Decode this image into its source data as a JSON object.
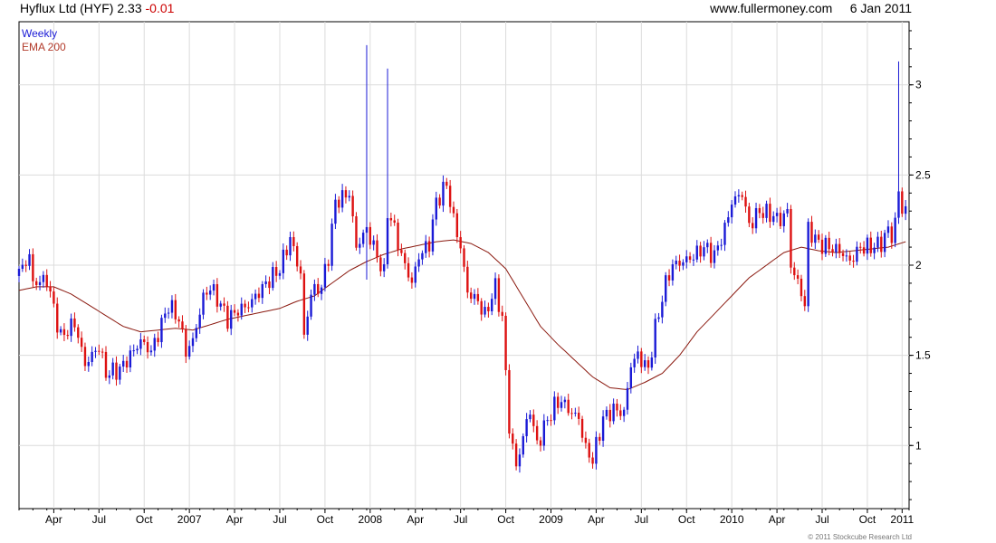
{
  "header": {
    "company": "Hyflux Ltd (HYF)",
    "price": "2.33",
    "change": "-0.01",
    "site": "www.fullermoney.com",
    "date": "6 Jan 2011"
  },
  "footer": {
    "copyright": "© 2011 Stockcube Research Ltd"
  },
  "colors": {
    "up": "#1a1ad6",
    "down": "#dd1111",
    "ema": "#8b1a10",
    "grid": "#dcdcdc"
  },
  "chart_data": {
    "type": "candlestick",
    "legend": [
      "Weekly",
      "EMA 200"
    ],
    "xlim": [
      0,
      256
    ],
    "ylim": [
      0.65,
      3.35
    ],
    "y_ticks": [
      1,
      1.5,
      2,
      2.5,
      3
    ],
    "y_tick_labels": [
      "1",
      "1.5",
      "2",
      "2.5",
      "3"
    ],
    "x_ticks": [
      {
        "label": "Apr",
        "x": 10
      },
      {
        "label": "Jul",
        "x": 23
      },
      {
        "label": "Oct",
        "x": 36
      },
      {
        "label": "2007",
        "x": 49
      },
      {
        "label": "Apr",
        "x": 62
      },
      {
        "label": "Jul",
        "x": 75
      },
      {
        "label": "Oct",
        "x": 88
      },
      {
        "label": "2008",
        "x": 101
      },
      {
        "label": "Apr",
        "x": 114
      },
      {
        "label": "Jul",
        "x": 127
      },
      {
        "label": "Oct",
        "x": 140
      },
      {
        "label": "2009",
        "x": 153
      },
      {
        "label": "Apr",
        "x": 166
      },
      {
        "label": "Jul",
        "x": 179
      },
      {
        "label": "Oct",
        "x": 192
      },
      {
        "label": "2010",
        "x": 205
      },
      {
        "label": "Apr",
        "x": 218
      },
      {
        "label": "Jul",
        "x": 231
      },
      {
        "label": "Oct",
        "x": 244
      },
      {
        "label": "2011",
        "x": 254
      }
    ],
    "close_anchors": [
      [
        0,
        1.96
      ],
      [
        3,
        2.05
      ],
      [
        4,
        1.9
      ],
      [
        8,
        1.92
      ],
      [
        12,
        1.6
      ],
      [
        16,
        1.68
      ],
      [
        19,
        1.45
      ],
      [
        23,
        1.55
      ],
      [
        25,
        1.4
      ],
      [
        29,
        1.42
      ],
      [
        32,
        1.5
      ],
      [
        35,
        1.58
      ],
      [
        38,
        1.52
      ],
      [
        40,
        1.62
      ],
      [
        43,
        1.78
      ],
      [
        46,
        1.7
      ],
      [
        48,
        1.52
      ],
      [
        50,
        1.58
      ],
      [
        53,
        1.82
      ],
      [
        55,
        1.88
      ],
      [
        58,
        1.78
      ],
      [
        60,
        1.7
      ],
      [
        63,
        1.75
      ],
      [
        66,
        1.78
      ],
      [
        69,
        1.85
      ],
      [
        72,
        1.92
      ],
      [
        75,
        1.98
      ],
      [
        78,
        2.15
      ],
      [
        81,
        1.95
      ],
      [
        82,
        1.6
      ],
      [
        84,
        1.85
      ],
      [
        87,
        1.88
      ],
      [
        89,
        2.05
      ],
      [
        91,
        2.35
      ],
      [
        95,
        2.4
      ],
      [
        97,
        2.1
      ],
      [
        100,
        2.2
      ],
      [
        103,
        2.05
      ],
      [
        105,
        1.95
      ],
      [
        106,
        2.3
      ],
      [
        108,
        2.2
      ],
      [
        110,
        2.05
      ],
      [
        113,
        1.9
      ],
      [
        115,
        2.05
      ],
      [
        118,
        2.12
      ],
      [
        120,
        2.35
      ],
      [
        123,
        2.45
      ],
      [
        125,
        2.25
      ],
      [
        127,
        2.1
      ],
      [
        129,
        1.85
      ],
      [
        132,
        1.8
      ],
      [
        134,
        1.72
      ],
      [
        137,
        1.88
      ],
      [
        139,
        1.7
      ],
      [
        141,
        1.1
      ],
      [
        143,
        0.88
      ],
      [
        145,
        1.05
      ],
      [
        147,
        1.2
      ],
      [
        149,
        1.0
      ],
      [
        151,
        1.1
      ],
      [
        154,
        1.22
      ],
      [
        156,
        1.25
      ],
      [
        158,
        1.2
      ],
      [
        161,
        1.15
      ],
      [
        163,
        0.98
      ],
      [
        165,
        0.92
      ],
      [
        168,
        1.15
      ],
      [
        171,
        1.2
      ],
      [
        174,
        1.18
      ],
      [
        176,
        1.45
      ],
      [
        178,
        1.5
      ],
      [
        181,
        1.42
      ],
      [
        183,
        1.65
      ],
      [
        186,
        1.9
      ],
      [
        188,
        2.0
      ],
      [
        191,
        2.02
      ],
      [
        194,
        2.05
      ],
      [
        197,
        2.1
      ],
      [
        200,
        2.05
      ],
      [
        203,
        2.2
      ],
      [
        205,
        2.35
      ],
      [
        208,
        2.4
      ],
      [
        210,
        2.22
      ],
      [
        213,
        2.3
      ],
      [
        216,
        2.28
      ],
      [
        219,
        2.25
      ],
      [
        221,
        2.3
      ],
      [
        222,
        2.0
      ],
      [
        225,
        1.85
      ],
      [
        226,
        1.78
      ],
      [
        227,
        2.2
      ],
      [
        230,
        2.12
      ],
      [
        233,
        2.1
      ],
      [
        236,
        2.08
      ],
      [
        239,
        2.02
      ],
      [
        242,
        2.1
      ],
      [
        245,
        2.1
      ],
      [
        248,
        2.12
      ],
      [
        250,
        2.2
      ],
      [
        251,
        2.15
      ],
      [
        252,
        2.25
      ],
      [
        253,
        2.4
      ],
      [
        254,
        2.3
      ],
      [
        255,
        2.33
      ]
    ],
    "ema_anchors": [
      [
        0,
        1.86
      ],
      [
        5,
        1.88
      ],
      [
        10,
        1.88
      ],
      [
        15,
        1.84
      ],
      [
        20,
        1.78
      ],
      [
        25,
        1.72
      ],
      [
        30,
        1.66
      ],
      [
        35,
        1.63
      ],
      [
        40,
        1.64
      ],
      [
        45,
        1.65
      ],
      [
        50,
        1.64
      ],
      [
        55,
        1.67
      ],
      [
        60,
        1.7
      ],
      [
        65,
        1.72
      ],
      [
        70,
        1.74
      ],
      [
        75,
        1.76
      ],
      [
        80,
        1.8
      ],
      [
        85,
        1.83
      ],
      [
        90,
        1.9
      ],
      [
        95,
        1.97
      ],
      [
        100,
        2.02
      ],
      [
        105,
        2.06
      ],
      [
        110,
        2.09
      ],
      [
        115,
        2.11
      ],
      [
        120,
        2.13
      ],
      [
        125,
        2.14
      ],
      [
        130,
        2.12
      ],
      [
        135,
        2.07
      ],
      [
        140,
        1.98
      ],
      [
        145,
        1.82
      ],
      [
        150,
        1.66
      ],
      [
        155,
        1.56
      ],
      [
        160,
        1.47
      ],
      [
        165,
        1.38
      ],
      [
        170,
        1.32
      ],
      [
        175,
        1.31
      ],
      [
        180,
        1.35
      ],
      [
        185,
        1.4
      ],
      [
        190,
        1.5
      ],
      [
        195,
        1.63
      ],
      [
        200,
        1.73
      ],
      [
        205,
        1.83
      ],
      [
        210,
        1.93
      ],
      [
        215,
        2.0
      ],
      [
        220,
        2.07
      ],
      [
        225,
        2.1
      ],
      [
        230,
        2.08
      ],
      [
        235,
        2.07
      ],
      [
        240,
        2.08
      ],
      [
        245,
        2.09
      ],
      [
        250,
        2.1
      ],
      [
        255,
        2.13
      ]
    ],
    "spikes": [
      {
        "x": 100,
        "high": 3.22,
        "low": 1.92
      },
      {
        "x": 106,
        "high": 3.09,
        "low": 2.05
      },
      {
        "x": 253,
        "high": 3.13,
        "low": 2.3
      }
    ]
  }
}
